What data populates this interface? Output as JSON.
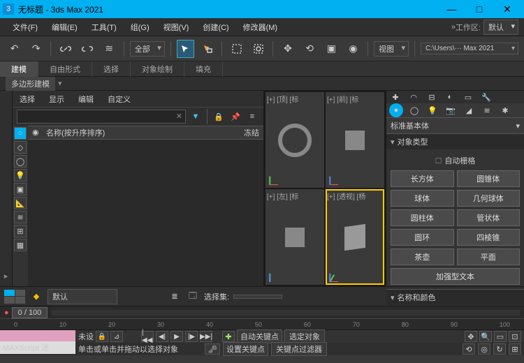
{
  "title": "无标题 - 3ds Max 2021",
  "menu": {
    "file": "文件(F)",
    "edit": "编辑(E)",
    "tools": "工具(T)",
    "group": "组(G)",
    "view": "视图(V)",
    "create": "创建(C)",
    "modifiers": "修改器(M)",
    "workspace_label": "工作区:",
    "workspace_value": "默认"
  },
  "toolbar": {
    "scope": "全部",
    "viewdd": "视图",
    "path": "C:\\Users\\··· Max 2021"
  },
  "ribbon": {
    "t1": "建模",
    "t2": "自由形式",
    "t3": "选择",
    "t4": "对象绘制",
    "t5": "填充"
  },
  "subribbon": {
    "tab": "多边形建模"
  },
  "scene": {
    "tabs": {
      "select": "选择",
      "display": "显示",
      "edit": "编辑",
      "custom": "自定义"
    },
    "col_name": "名称(按升序排序)",
    "col_freeze": "冻结"
  },
  "viewports": {
    "top": "[+] [顶] [标",
    "front": "[+] [前] [标",
    "left": "[+] [左] [标",
    "persp": "[+] [透视] [杨"
  },
  "right": {
    "category": "标准基本体",
    "roll_objtype": "对象类型",
    "autogrid": "自动栅格",
    "btns": {
      "box": "长方体",
      "cone": "圆锥体",
      "sphere": "球体",
      "geosphere": "几何球体",
      "cylinder": "圆柱体",
      "tube": "管状体",
      "torus": "圆环",
      "pyramid": "四棱锥",
      "teapot": "茶壶",
      "plane": "平面",
      "textplus": "加强型文本"
    },
    "roll_namecolor": "名称和颜色"
  },
  "bottom": {
    "layer": "默认",
    "selset_label": "选择集:"
  },
  "time": {
    "frame": "0 / 100",
    "ticks": [
      "0",
      "10",
      "20",
      "30",
      "40",
      "50",
      "60",
      "70",
      "80",
      "90",
      "100"
    ]
  },
  "status": {
    "script_label": "MAXScript 迷",
    "undo": "未设",
    "hint": "单击或单击并拖动以选择对象",
    "autokey": "自动关键点",
    "selobj": "选定对象",
    "setkey": "设置关键点",
    "keyfilter": "关键点过滤器"
  }
}
